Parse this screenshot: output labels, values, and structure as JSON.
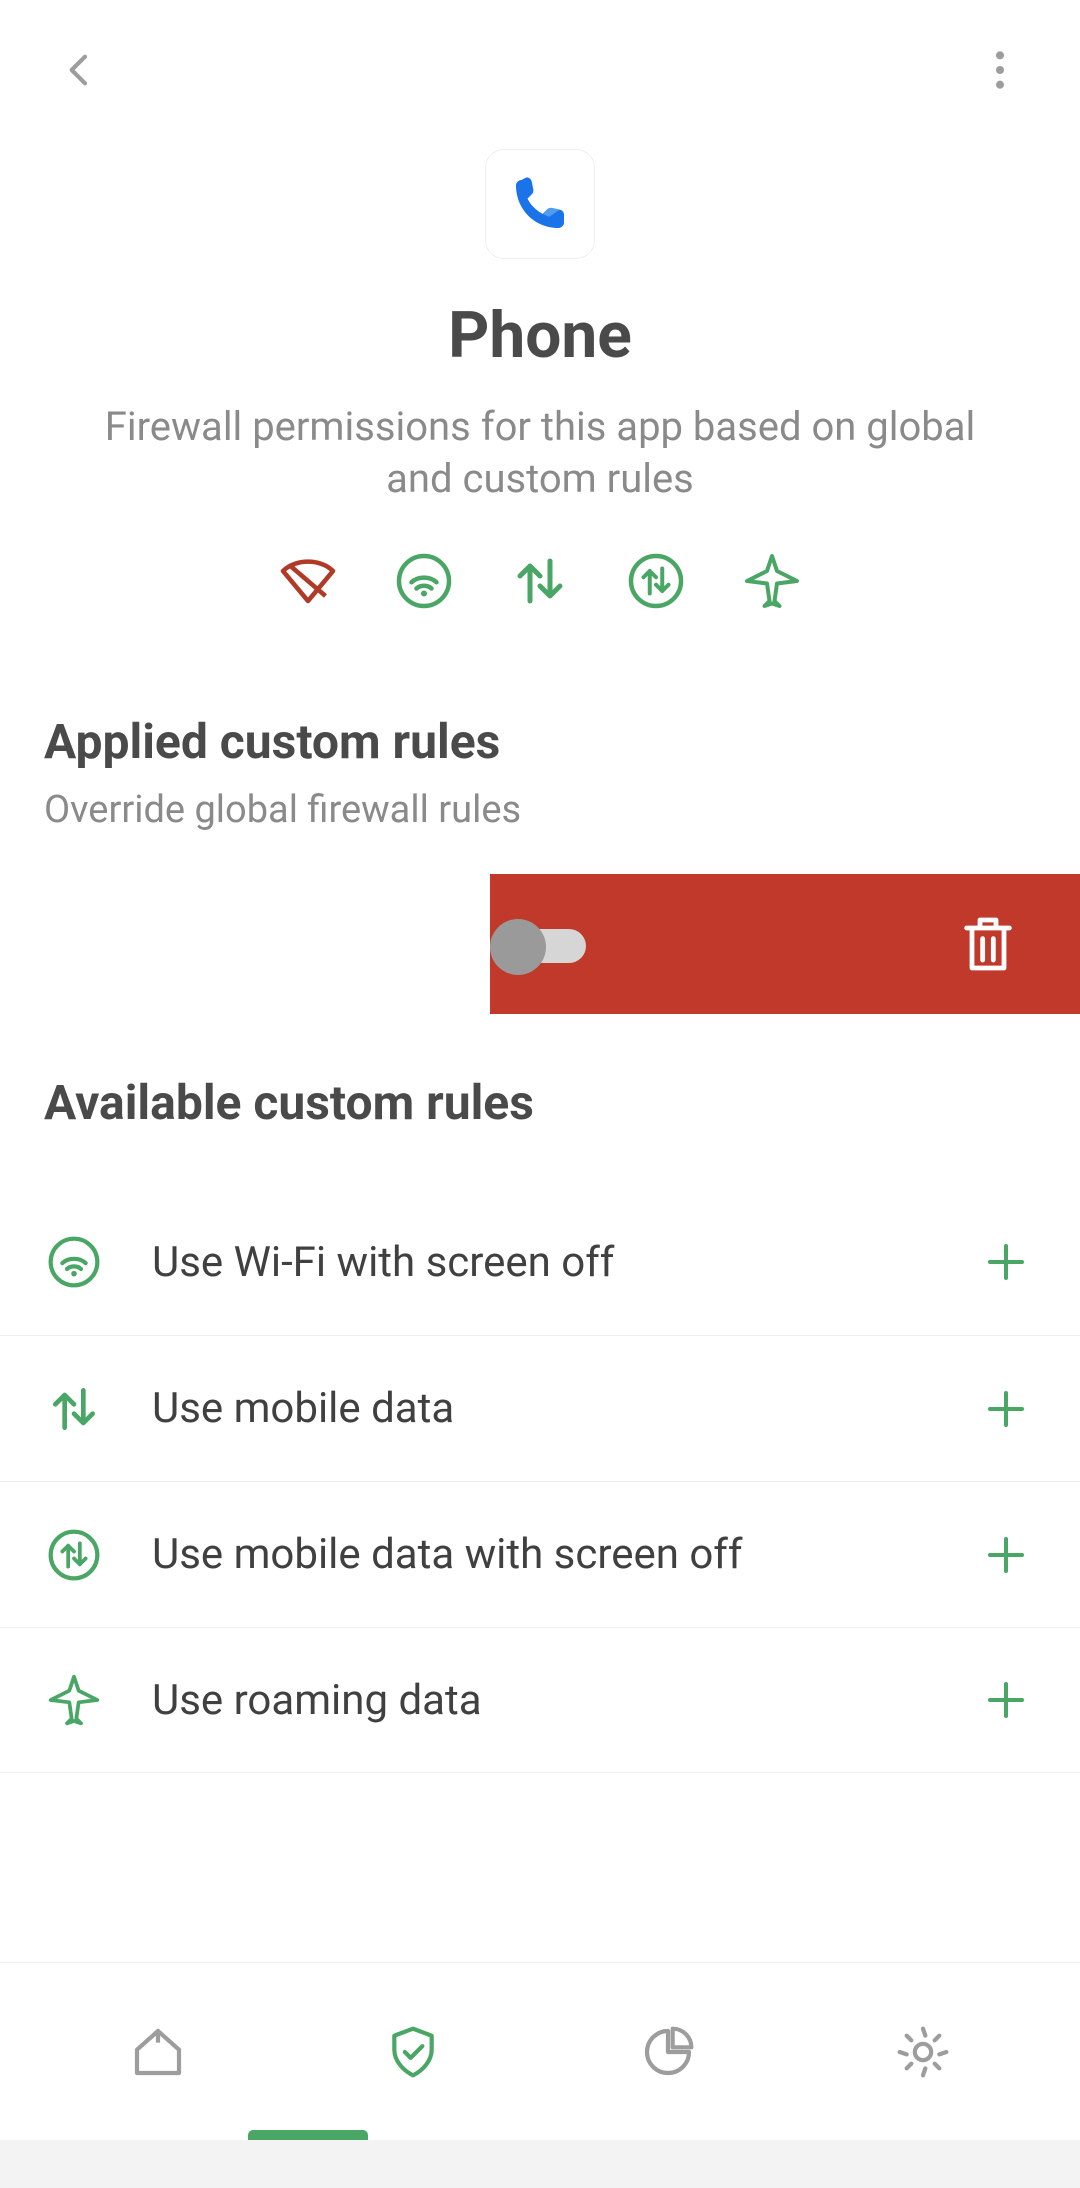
{
  "header": {
    "title": "Phone",
    "subtitle": "Firewall permissions for this app based on global and custom rules"
  },
  "permissions": [
    {
      "name": "wifi",
      "color": "#b13a27"
    },
    {
      "name": "wifi-circle",
      "color": "#4aa664"
    },
    {
      "name": "mobile-data",
      "color": "#4aa664"
    },
    {
      "name": "mobile-data-circle",
      "color": "#4aa664"
    },
    {
      "name": "airplane",
      "color": "#4aa664"
    }
  ],
  "appliedSection": {
    "title": "Applied custom rules",
    "subtitle": "Override global firewall rules"
  },
  "availableSection": {
    "title": "Available custom rules"
  },
  "availableRules": [
    {
      "icon": "wifi-circle",
      "label": "Use Wi-Fi with screen off"
    },
    {
      "icon": "mobile-data",
      "label": "Use mobile data"
    },
    {
      "icon": "mobile-data-circle",
      "label": "Use mobile data with screen off"
    },
    {
      "icon": "airplane",
      "label": "Use roaming data"
    }
  ],
  "colors": {
    "green": "#4aa664",
    "red": "#b13a27",
    "greyIcon": "#9d9d9d",
    "deletePanel": "#c0392b"
  }
}
